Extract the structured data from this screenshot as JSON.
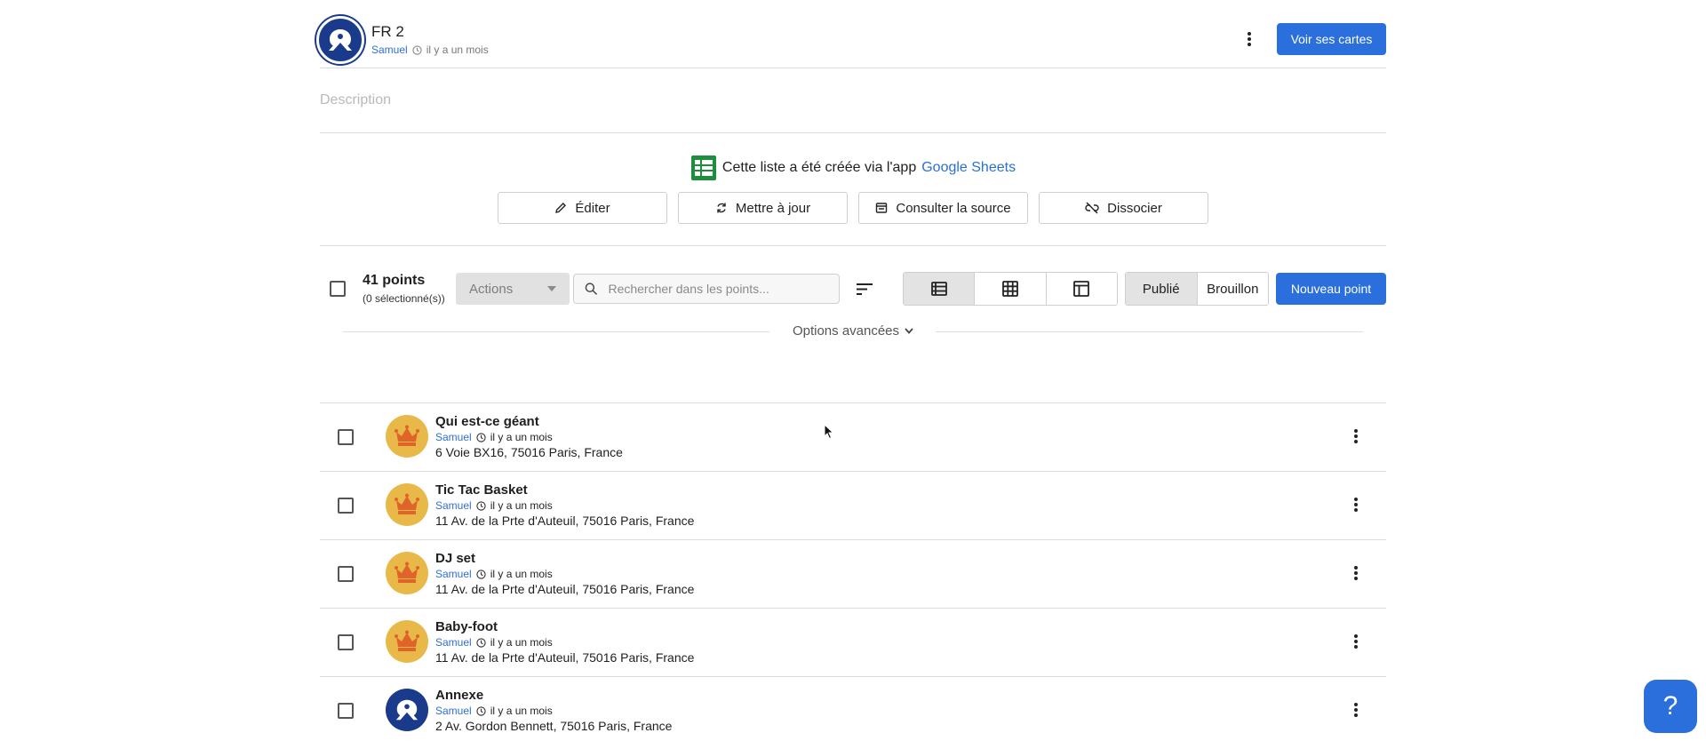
{
  "header": {
    "title": "FR 2",
    "author": "Samuel",
    "time": "il y a un mois",
    "cta_label": "Voir ses cartes"
  },
  "description_placeholder": "Description",
  "source": {
    "prefix": "Cette liste a été créée via l'app",
    "app_name": "Google Sheets"
  },
  "source_actions": [
    {
      "label": "Éditer",
      "icon": "pencil-icon"
    },
    {
      "label": "Mettre à jour",
      "icon": "refresh-icon"
    },
    {
      "label": "Consulter la source",
      "icon": "window-icon"
    },
    {
      "label": "Dissocier",
      "icon": "unlink-icon"
    }
  ],
  "toolbar": {
    "count_title": "41 points",
    "count_sub": "(0 sélectionné(s))",
    "actions_label": "Actions",
    "search_placeholder": "Rechercher dans les points...",
    "views": [
      "list-view-icon",
      "grid-view-icon",
      "table-view-icon"
    ],
    "status_published": "Publié",
    "status_draft": "Brouillon",
    "new_point_label": "Nouveau point",
    "advanced_label": "Options avancées"
  },
  "points": [
    {
      "title": "Qui est-ce géant",
      "author": "Samuel",
      "time": "il y a un mois",
      "address": "6 Voie BX16, 75016 Paris, France",
      "icon": "crown-icon"
    },
    {
      "title": "Tic Tac Basket",
      "author": "Samuel",
      "time": "il y a un mois",
      "address": "11 Av. de la Prte d'Auteuil, 75016 Paris, France",
      "icon": "crown-icon"
    },
    {
      "title": "DJ set",
      "author": "Samuel",
      "time": "il y a un mois",
      "address": "11 Av. de la Prte d'Auteuil, 75016 Paris, France",
      "icon": "crown-icon"
    },
    {
      "title": "Baby-foot",
      "author": "Samuel",
      "time": "il y a un mois",
      "address": "11 Av. de la Prte d'Auteuil, 75016 Paris, France",
      "icon": "crown-icon"
    },
    {
      "title": "Annexe",
      "author": "Samuel",
      "time": "il y a un mois",
      "address": "2 Av. Gordon Bennett, 75016 Paris, France",
      "icon": "brand-logo-icon"
    }
  ],
  "help_label": "?",
  "colors": {
    "primary": "#2a6fdb",
    "brand": "#1a3a8c",
    "crown_bg": "#e8b949",
    "sheets_green": "#1e8e3e"
  }
}
